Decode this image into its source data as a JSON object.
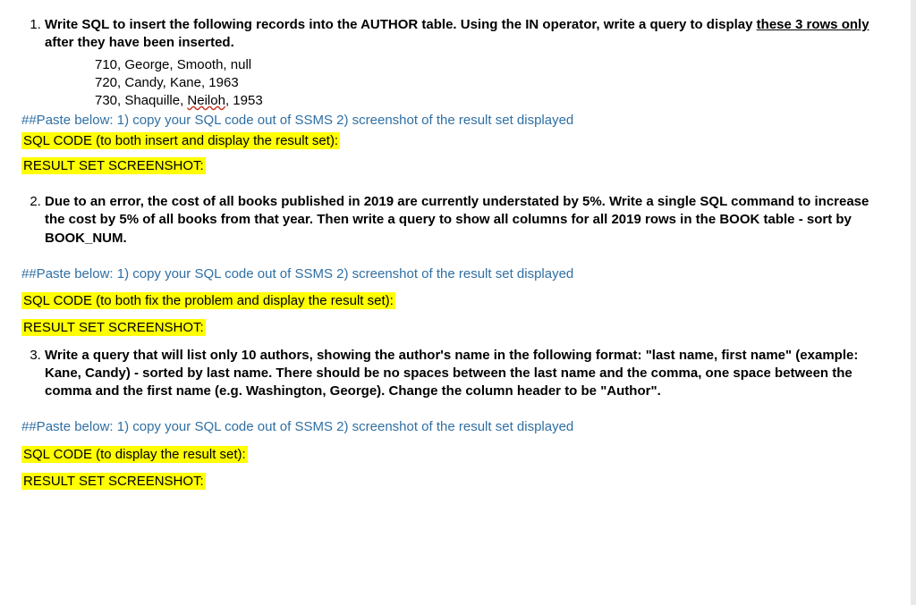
{
  "questions": [
    {
      "prompt_parts": {
        "before": "Write SQL to insert the following records into the AUTHOR table.  Using the IN operator, write a query to display ",
        "underlined": "these 3 rows only",
        "after": " after they have been inserted."
      },
      "data_rows": [
        "710, George, Smooth, null",
        "720, Candy, Kane, 1963",
        {
          "before": "730, Shaquille, ",
          "squiggle": "Neiloh",
          "after": ", 1953"
        }
      ],
      "paste_instruction": "##Paste below:  1) copy your SQL code out of SSMS  2) screenshot of the result set displayed",
      "sql_label": "SQL CODE (to both insert and display the result set):",
      "result_label": "RESULT SET SCREENSHOT:",
      "attach_instruction": true
    },
    {
      "prompt_parts": {
        "before": "Due to an error, the cost of all books published in 2019 are currently understated by 5%.  Write a single SQL command to increase the cost by 5% of all books from that year.  Then write a query to show all columns for all 2019 rows in the BOOK table - sort by BOOK_NUM.",
        "underlined": "",
        "after": ""
      },
      "data_rows": [],
      "paste_instruction": "##Paste below:  1) copy your SQL code out of SSMS  2) screenshot of the result set displayed",
      "sql_label": "SQL CODE (to both fix the problem and display the result set):",
      "result_label": "RESULT SET SCREENSHOT:",
      "attach_instruction": false
    },
    {
      "prompt_parts": {
        "before": "Write a query that will list only 10 authors, showing the author's name in the following format:  \"last name, first name\"  (example: Kane, Candy) - sorted by last name.  There should be no spaces between the last name and the comma, one space between the comma and the first name (e.g. Washington, George).  Change the column header to be \"Author\".",
        "underlined": "",
        "after": ""
      },
      "data_rows": [],
      "paste_instruction": "##Paste below:  1) copy your SQL code out of SSMS  2) screenshot of the result set displayed",
      "sql_label": "SQL CODE (to display the result set):",
      "result_label": "RESULT SET SCREENSHOT:",
      "attach_instruction": false
    }
  ]
}
